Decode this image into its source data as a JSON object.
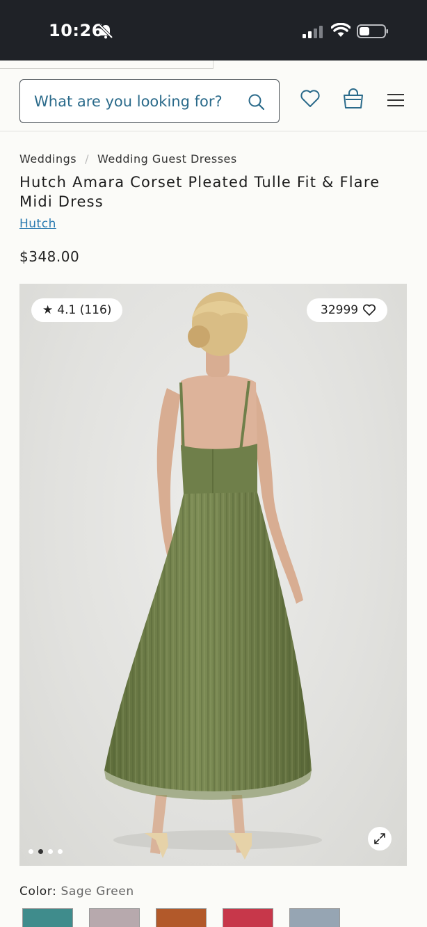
{
  "status_bar": {
    "time": "10:26",
    "icons": [
      "bell-muted-icon",
      "signal-icon",
      "wifi-icon",
      "battery-icon"
    ]
  },
  "header": {
    "search_placeholder": "What are you looking for?",
    "icons": [
      "search-icon",
      "heart-icon",
      "bag-icon",
      "menu-icon"
    ]
  },
  "breadcrumb": {
    "items": [
      "Weddings",
      "Wedding Guest Dresses"
    ],
    "separator": "/"
  },
  "product": {
    "title": "Hutch Amara Corset Pleated Tulle Fit & Flare Midi Dress",
    "brand": "Hutch",
    "price": "$348.00",
    "rating": "4.1 (116)",
    "likes": "32999",
    "image_count": 4,
    "active_image": 2,
    "color_label": "Color:",
    "color_value": "Sage Green",
    "swatch_colors": [
      "#3f8c8c",
      "#b7a9ad",
      "#b2592a",
      "#c7374a",
      "#96a5b3"
    ]
  },
  "colors": {
    "accent": "#2a6a8a",
    "link": "#2a7ab0",
    "status_bar": "#1f2227",
    "dress": "#6f7f4a"
  }
}
